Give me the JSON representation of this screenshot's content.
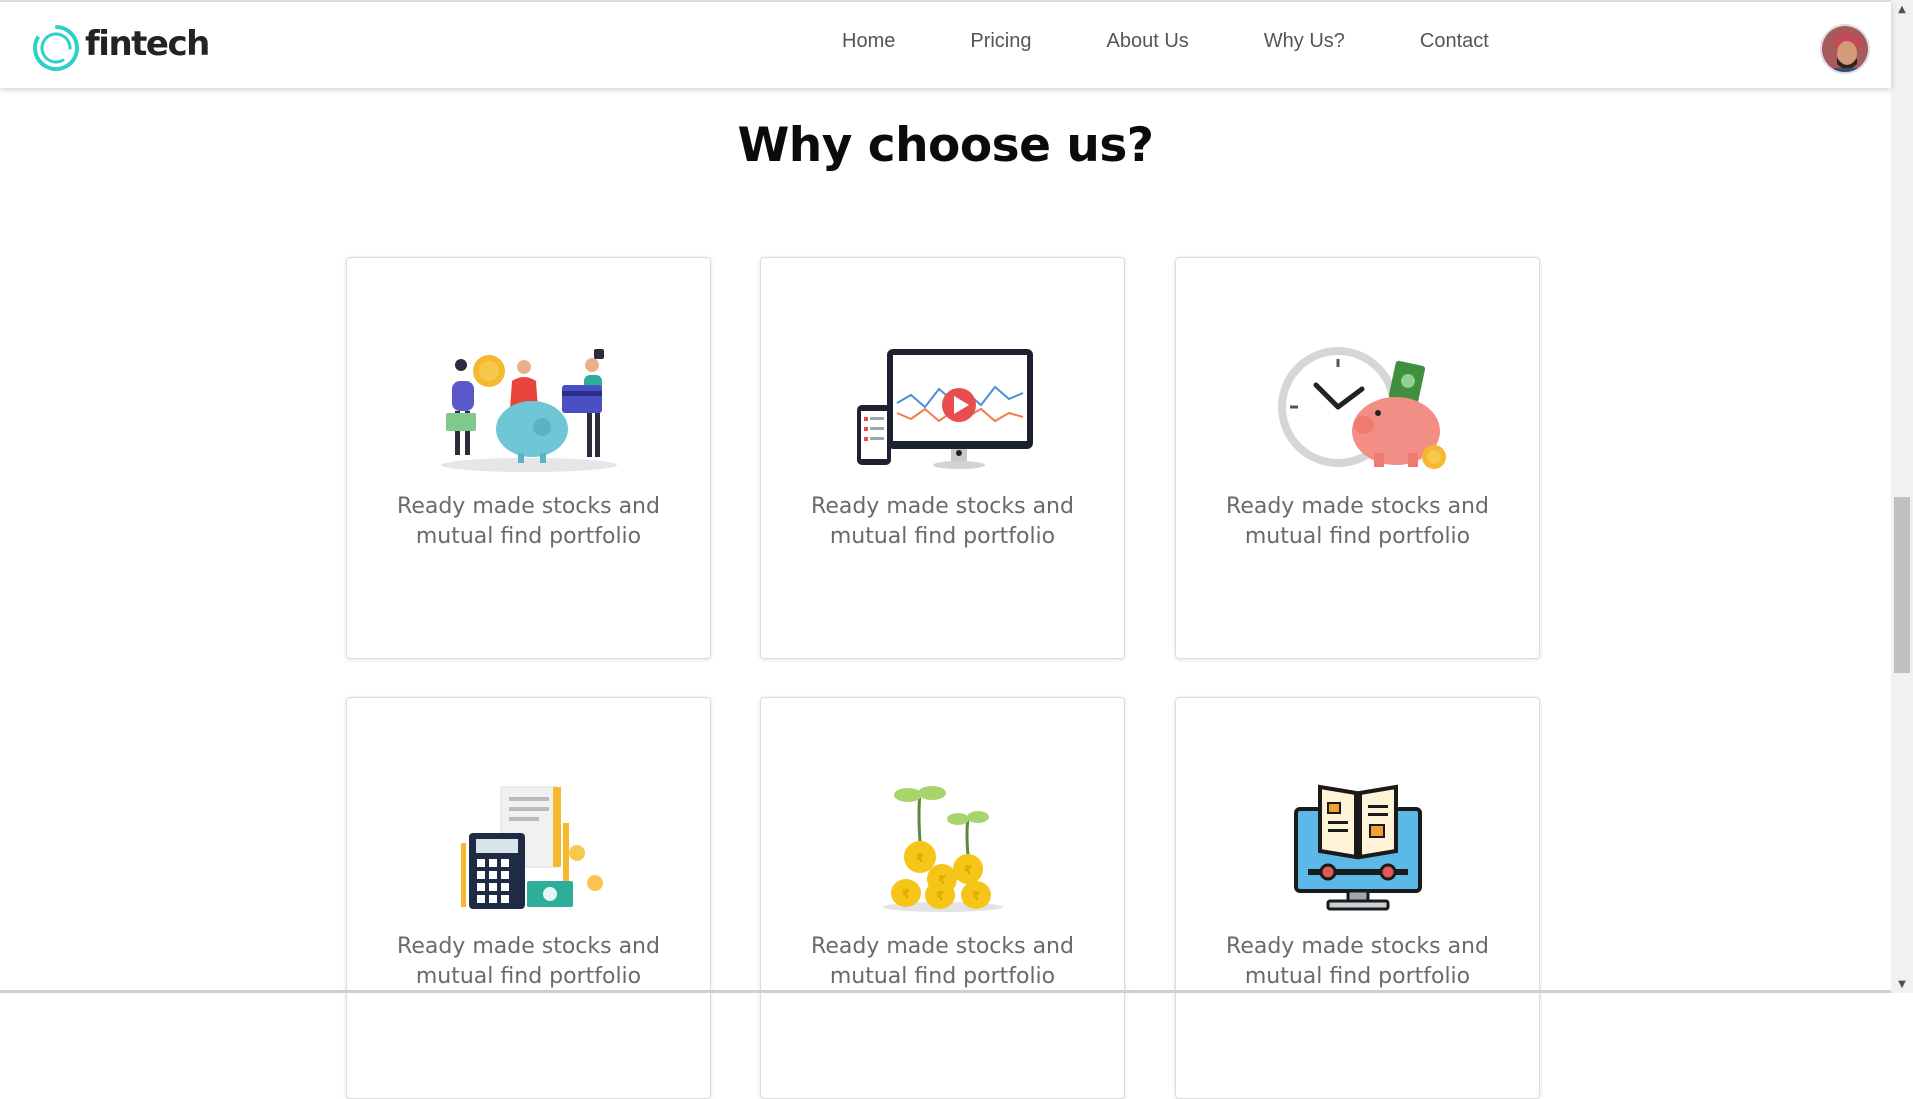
{
  "header": {
    "logo_text": "fintech",
    "nav": [
      "Home",
      "Pricing",
      "About Us",
      "Why Us?",
      "Contact"
    ],
    "brand_color": "#2fd0c5"
  },
  "section": {
    "title": "Why choose us?"
  },
  "cards": [
    {
      "icon": "family-savings-illustration",
      "text": "Ready made stocks and mutual find portfolio"
    },
    {
      "icon": "video-analytics-illustration",
      "text": "Ready made stocks and mutual find portfolio"
    },
    {
      "icon": "clock-piggy-bank-illustration",
      "text": "Ready made stocks and mutual find portfolio"
    },
    {
      "icon": "tax-calculator-illustration",
      "text": "Ready made stocks and mutual find portfolio"
    },
    {
      "icon": "money-growth-illustration",
      "text": "Ready made stocks and mutual find portfolio"
    },
    {
      "icon": "online-learning-illustration",
      "text": "Ready made stocks and mutual find portfolio"
    }
  ]
}
